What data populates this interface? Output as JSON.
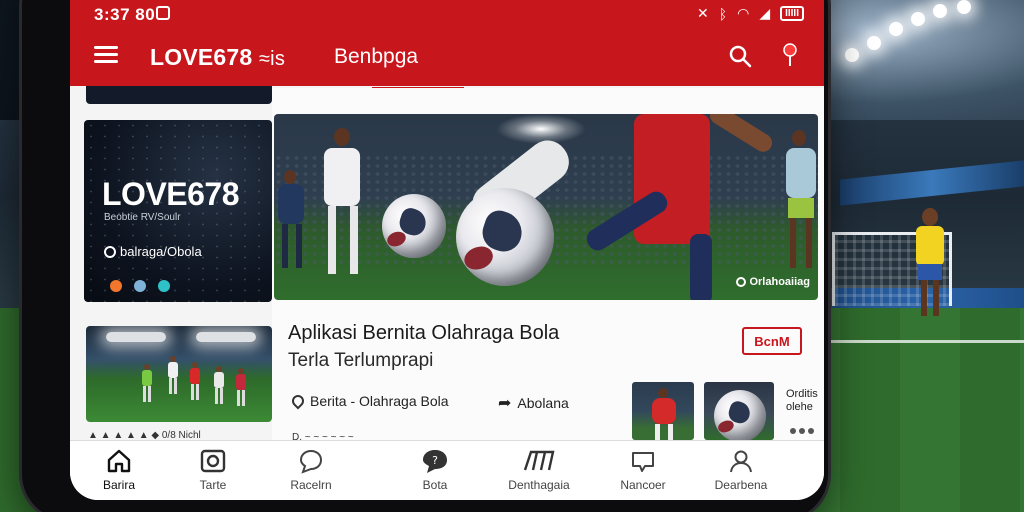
{
  "status_bar": {
    "time": "3:37 80",
    "battery": "IIIII"
  },
  "app_bar": {
    "title": "LOVE678",
    "title_suffix": "≈is",
    "active_tab": "Benbpga"
  },
  "logo_card": {
    "brand": "LOVE678",
    "tagline": "Beobtie RV/Soulr",
    "subtitle": "balraga/Obola",
    "dot_colors": [
      "#f2762b",
      "#7fb2d8",
      "#2ec2c8"
    ]
  },
  "left_bottom_text": "▲ ▲ ▲ ▲ ▲ ◆ 0/8 Nichl",
  "hero": {
    "caption": "Orlahoaiiag"
  },
  "article": {
    "title": "Aplikasi Bernita Olahraga Bola",
    "subtitle": "Terla Terlumprapi",
    "badge": "BcnM",
    "category": "Berita - Olahraga Bola",
    "share_label": "Abolana"
  },
  "side_snippet": {
    "text": "Orditis olehe"
  },
  "main_bottom_text": "D. ~ ~ ~ ~ ~ ~",
  "bottom_nav": {
    "items": [
      {
        "label": "Barira",
        "icon": "home-icon"
      },
      {
        "label": "Tarte",
        "icon": "camera-icon"
      },
      {
        "label": "Racelrn",
        "icon": "chat-bubble-icon"
      },
      {
        "label": "Bota",
        "icon": "message-icon"
      },
      {
        "label": "Denthagaia",
        "icon": "stats-icon"
      },
      {
        "label": "Nancoer",
        "icon": "comment-icon"
      },
      {
        "label": "Dearbena",
        "icon": "profile-icon"
      }
    ]
  },
  "colors": {
    "accent": "#c8161d",
    "nav_bg": "#ffffff",
    "screen_bg": "#f4f4f5"
  }
}
